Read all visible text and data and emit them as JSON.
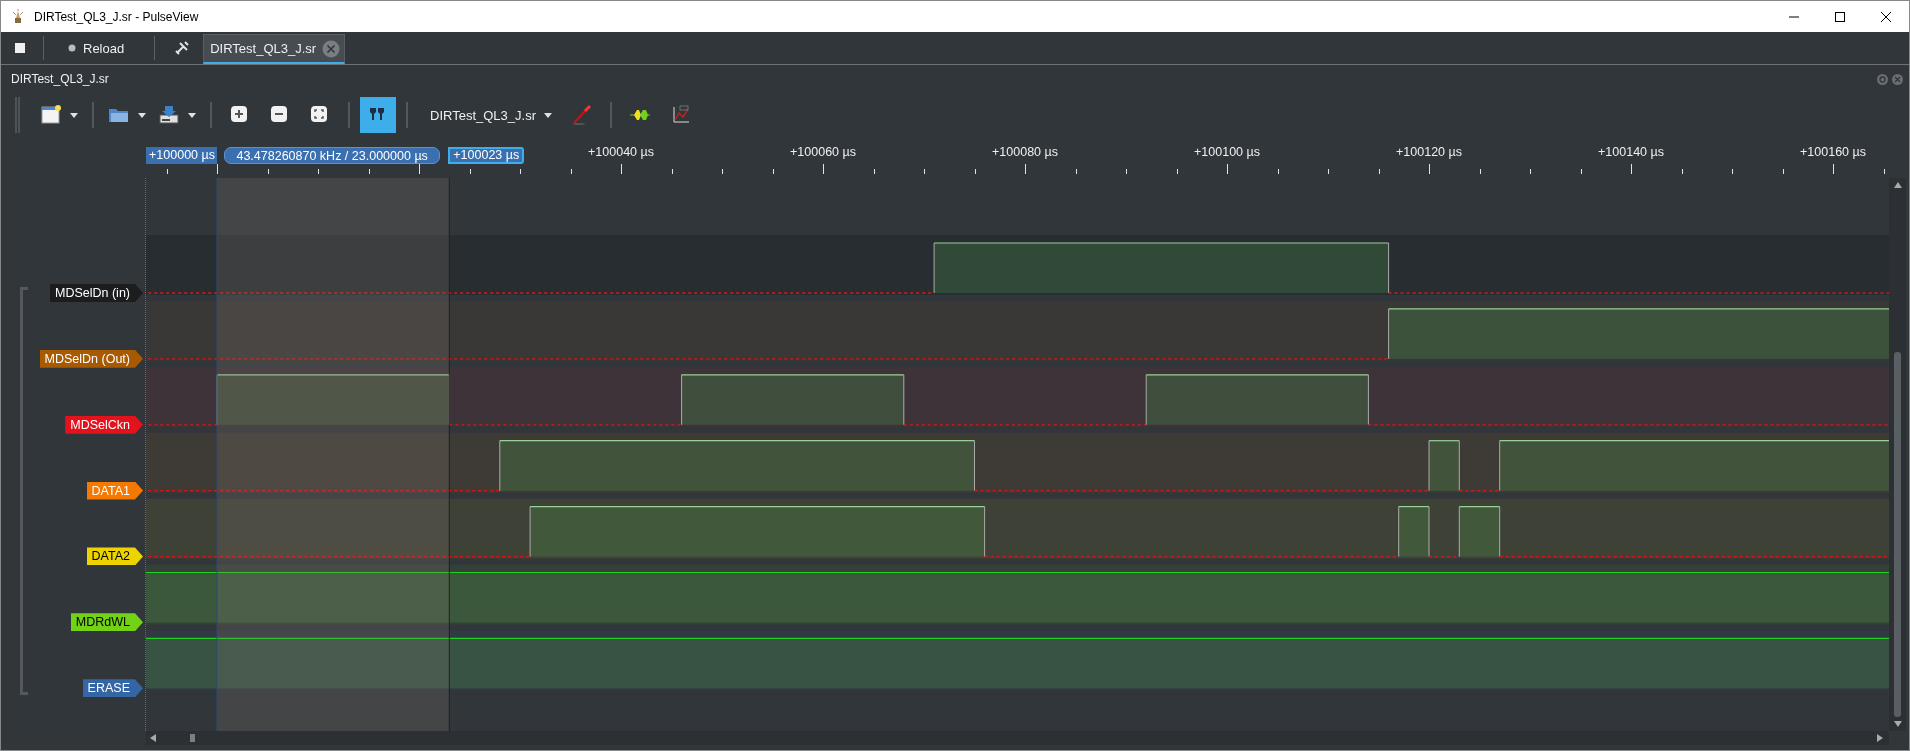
{
  "window": {
    "title": "DIRTest_QL3_J.sr - PulseView"
  },
  "main_toolbar": [
    {
      "kind": "stop"
    },
    {
      "kind": "reload",
      "label": "Reload"
    },
    {
      "kind": "tools"
    }
  ],
  "tabs": [
    {
      "label": "DIRTest_QL3_J.sr",
      "selected": true
    }
  ],
  "session": {
    "title": "DIRTest_QL3_J.sr",
    "toolbar": [
      {
        "kind": "new",
        "dropdown": true,
        "on": false
      },
      {
        "kind": "open",
        "dropdown": true,
        "on": false
      },
      {
        "kind": "save",
        "dropdown": true,
        "on": false
      },
      {
        "kind": "zoom-in",
        "dropdown": false,
        "on": false
      },
      {
        "kind": "zoom-out",
        "dropdown": false,
        "on": false
      },
      {
        "kind": "zoom-fit",
        "dropdown": false,
        "on": false
      },
      {
        "kind": "cursor",
        "dropdown": false,
        "on": true
      },
      {
        "kind": "device",
        "label": "DIRTest_QL3_J.sr",
        "dropdown": true,
        "on": false
      },
      {
        "kind": "probe",
        "dropdown": false,
        "on": false
      },
      {
        "kind": "decoder",
        "dropdown": false,
        "on": false
      },
      {
        "kind": "math",
        "dropdown": false,
        "on": false
      }
    ]
  },
  "ruler": {
    "labels": [
      "+100040 µs",
      "+100060 µs",
      "+100080 µs",
      "+100100 µs",
      "+100120 µs",
      "+100140 µs",
      "+100160 µs"
    ]
  },
  "cursors": {
    "start": "+100000 µs",
    "measure": "43.478260870 kHz / 23.000000 µs",
    "end": "+100023 µs"
  },
  "channels": [
    {
      "name": "MDSelDn (in)",
      "color": "#1b1d1f"
    },
    {
      "name": "MDSelDn (Out)",
      "color": "#a85a00"
    },
    {
      "name": "MDSelCkn",
      "color": "#e3121c"
    },
    {
      "name": "DATA1",
      "color": "#f57900"
    },
    {
      "name": "DATA2",
      "color": "#edd400"
    },
    {
      "name": "MDRdWL",
      "color": "#73d216"
    },
    {
      "name": "ERASE",
      "color": "#3465a4"
    }
  ]
}
